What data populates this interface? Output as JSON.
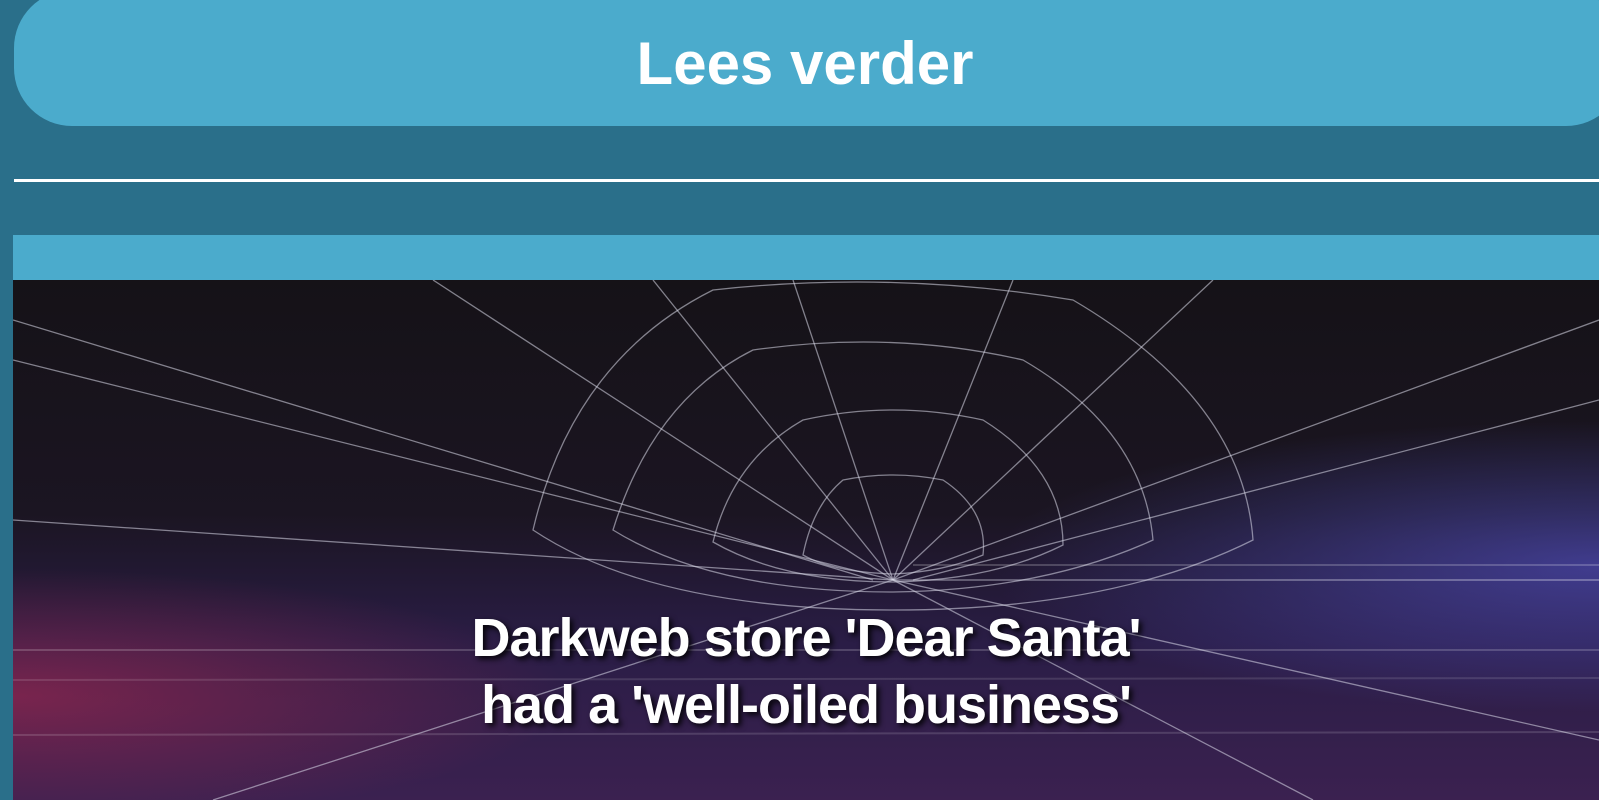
{
  "read_more": {
    "label": "Lees verder"
  },
  "article": {
    "headline_line1": "Darkweb store 'Dear Santa'",
    "headline_line2": "had a 'well-oiled business'"
  },
  "colors": {
    "background": "#2a6f8a",
    "button": "#4babcc",
    "text": "#ffffff"
  }
}
